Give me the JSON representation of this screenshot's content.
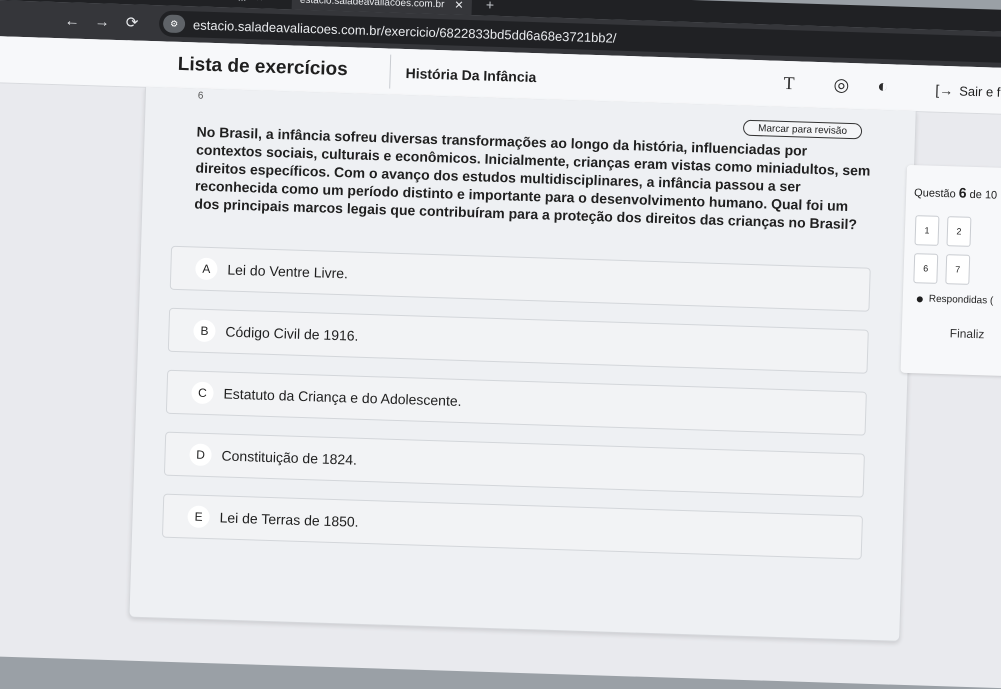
{
  "browser": {
    "tabs": [
      {
        "label": "...",
        "active": false
      },
      {
        "label": "estacio.saladeavaliacoes.com.br",
        "active": true
      }
    ],
    "address": "estacio.saladeavaliacoes.com.br/exercicio/6822833bd5dd6a68e3721bb2/"
  },
  "header": {
    "title": "Lista de exercícios",
    "subject": "História Da Infância",
    "exit_label": "Sair e fi"
  },
  "question": {
    "number": "6",
    "review_label": "Marcar para revisão",
    "text": "No Brasil, a infância sofreu diversas transformações ao longo da história, influenciadas por contextos sociais, culturais e econômicos. Inicialmente, crianças eram vistas como miniadultos, sem direitos específicos. Com o avanço dos estudos multidisciplinares, a infância passou a ser reconhecida como um período distinto e importante para o desenvolvimento humano. Qual foi um dos principais marcos legais que contribuíram para a proteção dos direitos das crianças no Brasil?",
    "options": [
      {
        "letter": "A",
        "text": "Lei do Ventre Livre."
      },
      {
        "letter": "B",
        "text": "Código Civil de 1916."
      },
      {
        "letter": "C",
        "text": "Estatuto da Criança e do Adolescente."
      },
      {
        "letter": "D",
        "text": "Constituição de 1824."
      },
      {
        "letter": "E",
        "text": "Lei de Terras de 1850."
      }
    ]
  },
  "sidebar": {
    "q_prefix": "Questão",
    "q_current": "6",
    "q_suffix": "de 10",
    "buttons": [
      "1",
      "2",
      "6",
      "7"
    ],
    "legend": "Respondidas (",
    "finish": "Finaliz"
  }
}
